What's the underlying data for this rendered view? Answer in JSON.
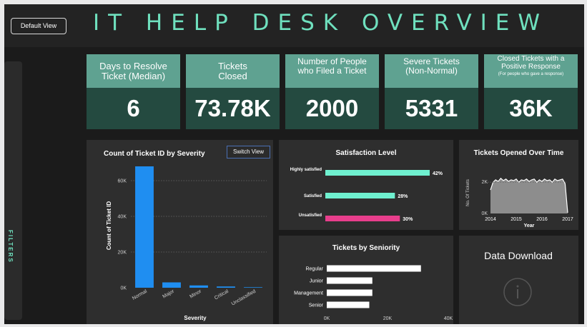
{
  "header": {
    "default_view_label": "Default View",
    "title": "IT HELP DESK OVERVIEW"
  },
  "filters": {
    "label": "FILTERS"
  },
  "kpis": [
    {
      "title_line1": "Days to Resolve",
      "title_line2": "Ticket (Median)",
      "value": "6"
    },
    {
      "title_line1": "Tickets",
      "title_line2": "Closed",
      "value": "73.78K"
    },
    {
      "title_line1": "Number of People",
      "title_line2": "who Filed a Ticket",
      "value": "2000"
    },
    {
      "title_line1": "Severe Tickets",
      "title_line2": "(Non-Normal)",
      "value": "5331"
    },
    {
      "title_line1": "Closed Tickets with a",
      "title_line2": "Positive Response",
      "subtitle": "(For people who gave a response)",
      "value": "36K"
    }
  ],
  "severity_panel": {
    "switch_label": "Switch View"
  },
  "data_download": {
    "title": "Data Download",
    "icon": "info-icon"
  },
  "colors": {
    "accent": "#6fe0be",
    "kpi_head": "#5fa291",
    "kpi_body": "#244a40",
    "bar_blue": "#1f8ef1",
    "bar_teal": "#6ff0cf",
    "bar_pink": "#e83e8c"
  },
  "chart_data": [
    {
      "type": "bar",
      "title": "Count of Ticket ID by Severity",
      "xlabel": "Severity",
      "ylabel": "Count of Ticket ID",
      "categories": [
        "Normal",
        "Major",
        "Minor",
        "Critical",
        "Unclassified"
      ],
      "values": [
        68000,
        3000,
        1300,
        700,
        300
      ],
      "ylim": [
        0,
        70000
      ],
      "yticks": [
        "0K",
        "20K",
        "40K",
        "60K"
      ],
      "ytick_values": [
        0,
        20000,
        40000,
        60000
      ],
      "grid": true
    },
    {
      "type": "bar",
      "title": "Satisfaction Level",
      "orientation": "horizontal",
      "categories": [
        "Highly satisfied",
        "Satisfied",
        "Unsatisfied"
      ],
      "values": [
        42,
        28,
        30
      ],
      "data_labels": [
        "42%",
        "28%",
        "30%"
      ]
    },
    {
      "type": "area",
      "title": "Tickets Opened Over Time",
      "xlabel": "Year",
      "ylabel": "No. Of Tickets",
      "xticks": [
        "2014",
        "2015",
        "2016",
        "2017"
      ],
      "yticks": [
        "0K",
        "2K"
      ],
      "xlim": [
        2014,
        2017
      ],
      "ylim": [
        0,
        2600
      ],
      "x": [
        2014.0,
        2014.1,
        2014.2,
        2014.3,
        2014.4,
        2014.5,
        2014.6,
        2014.7,
        2014.8,
        2014.9,
        2015.0,
        2015.1,
        2015.2,
        2015.3,
        2015.4,
        2015.5,
        2015.6,
        2015.7,
        2015.8,
        2015.9,
        2016.0,
        2016.1,
        2016.2,
        2016.3,
        2016.4,
        2016.5,
        2016.6,
        2016.7,
        2016.8,
        2016.9,
        2017.0
      ],
      "values": [
        1500,
        2000,
        2150,
        2050,
        2250,
        2100,
        2200,
        2050,
        2150,
        2100,
        2200,
        2000,
        2150,
        2100,
        2200,
        2050,
        2150,
        2200,
        2000,
        2150,
        2050,
        2200,
        2100,
        2150,
        2000,
        2200,
        2100,
        2150,
        2200,
        1900,
        50
      ]
    },
    {
      "type": "bar",
      "title": "Tickets by Seniority",
      "orientation": "horizontal",
      "categories": [
        "Regular",
        "Junior",
        "Management",
        "Senior"
      ],
      "values": [
        31000,
        15000,
        15000,
        14000
      ],
      "xlim": [
        0,
        40000
      ],
      "xticks": [
        "0K",
        "20K",
        "40K"
      ],
      "xtick_values": [
        0,
        20000,
        40000
      ]
    }
  ]
}
